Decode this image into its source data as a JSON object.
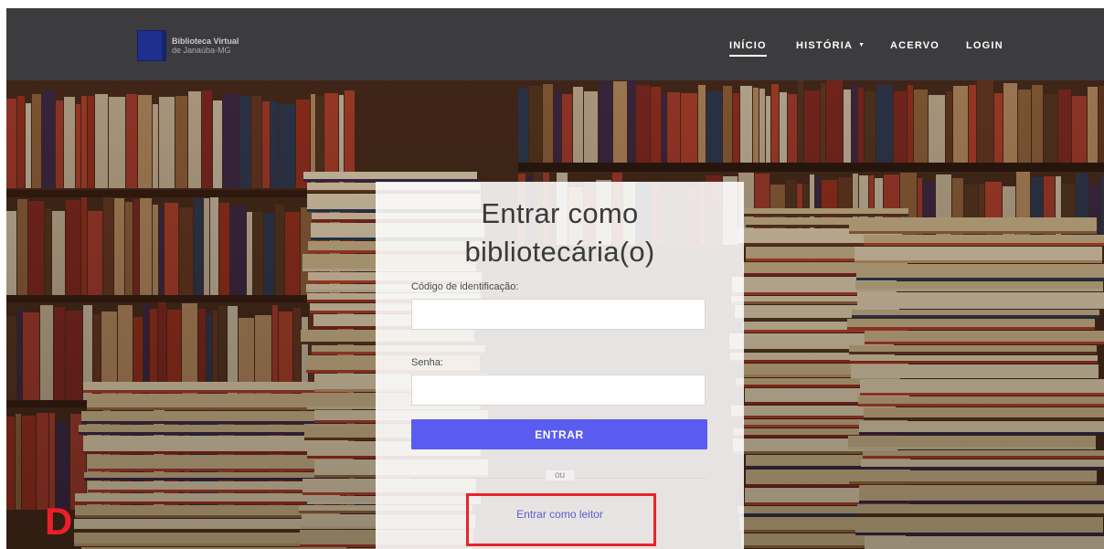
{
  "brand": {
    "line1": "Biblioteca Virtual",
    "line2": "de Janaúba-MG"
  },
  "nav": {
    "items": [
      {
        "label": "INÍCIO",
        "active": true
      },
      {
        "label": "HISTÓRIA",
        "dropdown": true
      },
      {
        "label": "ACERVO"
      },
      {
        "label": "LOGIN"
      }
    ],
    "caret": "▼"
  },
  "login": {
    "title_line1": "Entrar como",
    "title_line2": "bibliotecária(o)",
    "code_label": "Código de identificação:",
    "code_value": "",
    "password_label": "Senha:",
    "password_value": "",
    "submit_label": "ENTRAR",
    "divider_text": "ou",
    "reader_link": "Entrar como leitor"
  },
  "watermark": "D",
  "colors": {
    "navbar": "#3c3c3e",
    "accent": "#5a5cf0",
    "link": "#5b5ecf",
    "highlight": "#e8242b"
  }
}
